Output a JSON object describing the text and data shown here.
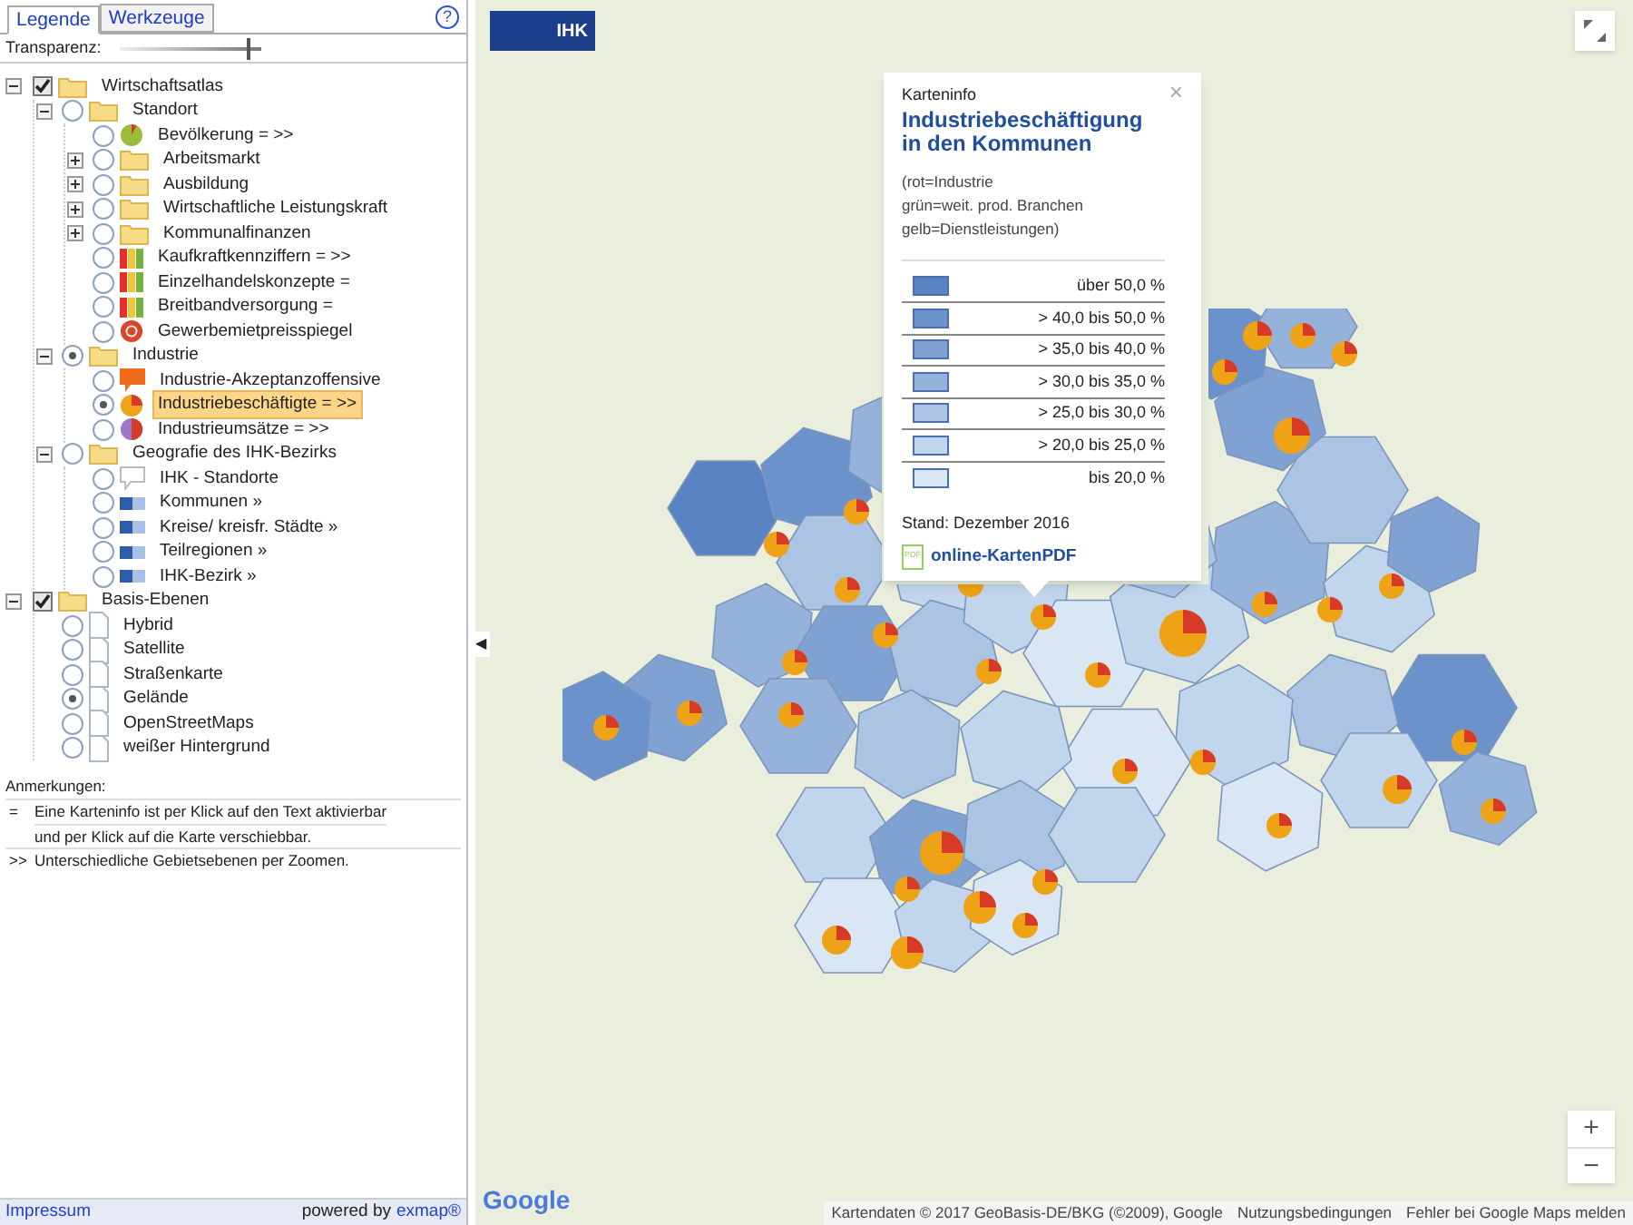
{
  "tabs": [
    {
      "label": "Legende",
      "selected": true
    },
    {
      "label": "Werkzeuge",
      "selected": false
    }
  ],
  "help": "?",
  "transparency": {
    "label": "Transparenz:",
    "level": 0.9
  },
  "tree": [
    {
      "label": "Wirtschaftsatlas",
      "checked": true,
      "kind": "folder",
      "expanded": true,
      "children": [
        {
          "label": "Standort",
          "checked": false,
          "kind": "folder",
          "expanded": true,
          "children": [
            {
              "label": "Bevölkerung = >>",
              "checked": false,
              "kind": "pie-green"
            },
            {
              "label": "Arbeitsmarkt",
              "checked": false,
              "kind": "folder",
              "expanded": false
            },
            {
              "label": "Ausbildung",
              "checked": false,
              "kind": "folder",
              "expanded": false
            },
            {
              "label": "Wirtschaftliche Leistungskraft",
              "checked": false,
              "kind": "folder",
              "expanded": false
            },
            {
              "label": "Kommunalfinanzen",
              "checked": false,
              "kind": "folder",
              "expanded": false
            },
            {
              "label": "Kaufkraftkennziffern = >>",
              "checked": false,
              "kind": "bars"
            },
            {
              "label": "Einzelhandelskonzepte =",
              "checked": false,
              "kind": "bars"
            },
            {
              "label": "Breitbandversorgung =",
              "checked": false,
              "kind": "bars"
            },
            {
              "label": "Gewerbemietpreisspiegel",
              "checked": false,
              "kind": "target"
            }
          ]
        },
        {
          "label": "Industrie",
          "checked": true,
          "kind": "folder",
          "expanded": true,
          "children": [
            {
              "label": "Industrie-Akzeptanzoffensive",
              "checked": false,
              "kind": "speech"
            },
            {
              "label": "Industriebeschäftigte = >>",
              "checked": true,
              "kind": "pie-orange",
              "highlighted": true
            },
            {
              "label": "Industrieumsätze = >>",
              "checked": false,
              "kind": "pie-red"
            }
          ]
        },
        {
          "label": "Geografie des IHK-Bezirks",
          "checked": false,
          "kind": "folder",
          "expanded": true,
          "children": [
            {
              "label": "IHK - Standorte",
              "checked": false,
              "kind": "marker"
            },
            {
              "label": "Kommunen »",
              "checked": false,
              "kind": "blue-bar"
            },
            {
              "label": "Kreise/ kreisfr. Städte »",
              "checked": false,
              "kind": "blue-bar"
            },
            {
              "label": "Teilregionen »",
              "checked": false,
              "kind": "blue-bar"
            },
            {
              "label": "IHK-Bezirk »",
              "checked": false,
              "kind": "blue-bar"
            }
          ]
        }
      ]
    },
    {
      "label": "Basis-Ebenen",
      "checked": true,
      "kind": "folder",
      "expanded": true,
      "children": [
        {
          "label": "Hybrid",
          "checked": false,
          "kind": "page"
        },
        {
          "label": "Satellite",
          "checked": false,
          "kind": "page"
        },
        {
          "label": "Straßenkarte",
          "checked": false,
          "kind": "page"
        },
        {
          "label": "Gelände",
          "checked": true,
          "kind": "page"
        },
        {
          "label": "OpenStreetMaps",
          "checked": false,
          "kind": "page"
        },
        {
          "label": "weißer Hintergrund",
          "checked": false,
          "kind": "page"
        }
      ]
    }
  ],
  "notes": {
    "title": "Anmerkungen:",
    "items": [
      {
        "symbol": "=",
        "lines": [
          "Eine Karteninfo ist per Klick auf den Text aktivierbar",
          "und per Klick auf die Karte verschiebbar."
        ]
      },
      {
        "symbol": ">>",
        "lines": [
          "Unterschiedliche Gebietsebenen per Zoomen."
        ]
      }
    ]
  },
  "footer": {
    "link": "Impressum",
    "powered": "powered by",
    "brand": "exmap®"
  },
  "map": {
    "logo": "IHK",
    "collapse": "◀",
    "google": "Google",
    "attribution": [
      "Kartendaten © 2017 GeoBasis-DE/BKG (©2009), Google",
      "Nutzungsbedingungen",
      "Fehler bei Google Maps melden"
    ],
    "zoom_in": "+",
    "zoom_out": "−"
  },
  "popup": {
    "label": "Karteninfo",
    "close": "×",
    "title": "Industriebeschäftigung in den Kommunen",
    "description": [
      "(rot=Industrie",
      "grün=weit. prod. Branchen",
      "gelb=Dienstleistungen)"
    ],
    "legend": [
      {
        "label": "über 50,0 %",
        "color": "#5a83c3"
      },
      {
        "label": "> 40,0 bis 50,0 %",
        "color": "#6c92cb"
      },
      {
        "label": "> 35,0 bis 40,0 %",
        "color": "#80a2d3"
      },
      {
        "label": "> 30,0 bis 35,0 %",
        "color": "#95b2db"
      },
      {
        "label": "> 25,0 bis 30,0 %",
        "color": "#abc4e4"
      },
      {
        "label": "> 20,0 bis 25,0 %",
        "color": "#c1d5ec"
      },
      {
        "label": "bis 20,0 %",
        "color": "#d9e6f4"
      }
    ],
    "date": "Stand: Dezember 2016",
    "pdf_icon": "PDF",
    "pdf_link": "online-KartenPDF"
  }
}
